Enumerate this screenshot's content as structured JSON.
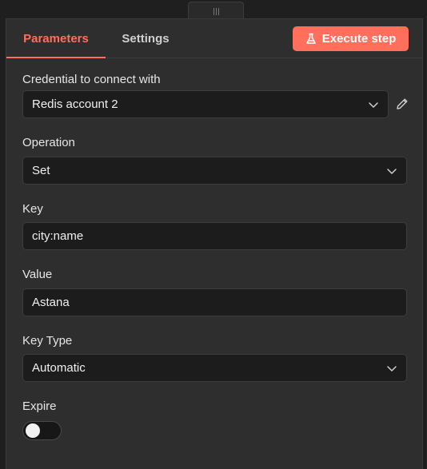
{
  "tabs": {
    "parameters": "Parameters",
    "settings": "Settings"
  },
  "execute_button": {
    "label": "Execute step",
    "icon": "flask-icon",
    "color": "#ff6f5c"
  },
  "credential": {
    "label": "Credential to connect with",
    "value": "Redis account 2",
    "edit_icon": "pencil-icon"
  },
  "operation": {
    "label": "Operation",
    "value": "Set"
  },
  "key": {
    "label": "Key",
    "value": "city:name"
  },
  "value_field": {
    "label": "Value",
    "value": "Astana"
  },
  "key_type": {
    "label": "Key Type",
    "value": "Automatic"
  },
  "expire": {
    "label": "Expire",
    "enabled": false
  },
  "colors": {
    "accent": "#ff6f5c",
    "panel_bg": "#2e2e2e",
    "input_bg": "#1c1c1c"
  }
}
